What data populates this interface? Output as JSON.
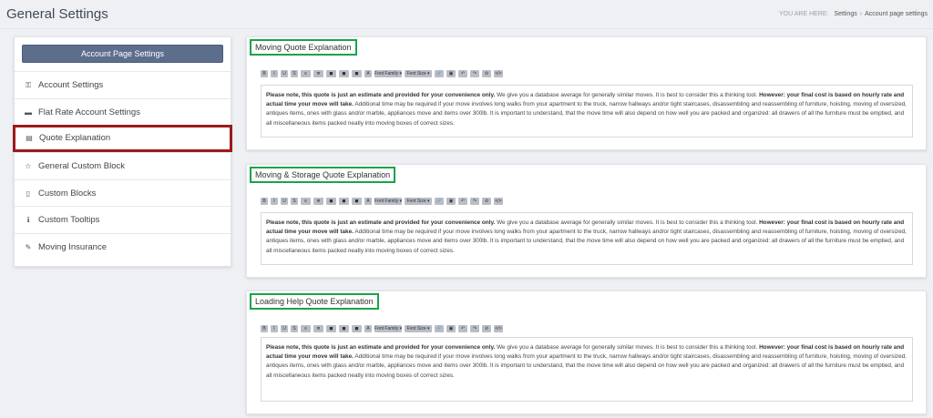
{
  "header": {
    "title": "General Settings",
    "breadcrumb_label": "YOU ARE HERE:",
    "breadcrumb": [
      "Settings",
      "Account page settings"
    ],
    "separator": "›"
  },
  "sidebar": {
    "button_label": "Account Page Settings",
    "items": [
      {
        "label": "Account Settings",
        "icon": "key-icon",
        "glyph": "⚿"
      },
      {
        "label": "Flat Rate Account Settings",
        "icon": "truck-icon",
        "glyph": "▬"
      },
      {
        "label": "Quote Explanation",
        "icon": "document-icon",
        "glyph": "▤"
      },
      {
        "label": "General Custom Block",
        "icon": "star-icon",
        "glyph": "☆"
      },
      {
        "label": "Custom Blocks",
        "icon": "bookmark-icon",
        "glyph": "▯"
      },
      {
        "label": "Custom Tooltips",
        "icon": "info-icon",
        "glyph": "ℹ"
      },
      {
        "label": "Moving Insurance",
        "icon": "edit-icon",
        "glyph": "✎"
      }
    ],
    "active_index": 2
  },
  "toolbar": {
    "buttons": [
      "B",
      "I",
      "U",
      "S",
      "≡",
      "≣",
      "◼",
      "◼",
      "◼",
      "A",
      "Font Family ▾",
      "Font Size ▾",
      "🔗",
      "▣",
      "↶",
      "↷",
      "⊘",
      "</>"
    ]
  },
  "cards": [
    {
      "title": "Moving Quote Explanation",
      "text_bold": "Please note, this quote is just an estimate and provided for your convenience only.",
      "text_1": " We give you a database average for generally similar moves. It is best to consider this a thinking tool. ",
      "text_bold_2": "However: your final cost is based on hourly rate and actual time your move will take.",
      "text_2": " Additional time may be required if your move involves long walks from your apartment to the truck, narrow hallways and/or tight staircases, disassembling and reassembling of furniture, hoisting, moving of oversized, antiques items, ones with glass and/or marble, appliances move and items over 300lb. It is important to understand, that the move time will also depend on how well you are packed and organized: all drawers of all the furniture must be emptied, and all miscellaneous items packed neatly into moving boxes of correct sizes."
    },
    {
      "title": "Moving & Storage Quote Explanation",
      "text_bold": "Please note, this quote is just an estimate and provided for your convenience only.",
      "text_1": " We give you a database average for generally similar moves. It is best to consider this a thinking tool. ",
      "text_bold_2": "However: your final cost is based on hourly rate and actual time your move will take.",
      "text_2": " Additional time may be required if your move involves long walks from your apartment to the truck, narrow hallways and/or tight staircases, disassembling and reassembling of furniture, hoisting, moving of oversized, antiques items, ones with glass and/or marble, appliances move and items over 300lb. It is important to understand, that the move time will also depend on how well you are packed and organized: all drawers of all the furniture must be emptied, and all miscellaneous items packed neatly into moving boxes of correct sizes."
    },
    {
      "title": "Loading Help Quote Explanation",
      "text_bold": "Please note, this quote is just an estimate and provided for your convenience only.",
      "text_1": " We give you a database average for generally similar moves. It is best to consider this a thinking tool. ",
      "text_bold_2": "However: your final cost is based on hourly rate and actual time your move will take.",
      "text_2": " Additional time may be required if your move involves long walks from your apartment to the truck, narrow hallways and/or tight staircases, disassembling and reassembling of furniture, hoisting, moving of oversized, antiques items, ones with glass and/or marble, appliances move and items over 300lb. It is important to understand, that the move time will also depend on how well you are packed and organized: all drawers of all the furniture must be emptied, and all miscellaneous items packed neatly into moving boxes of correct sizes."
    }
  ],
  "colors": {
    "accent_button": "#5c6e8c",
    "active_outline": "#9b1b1b",
    "title_outline": "#1aa34a"
  }
}
